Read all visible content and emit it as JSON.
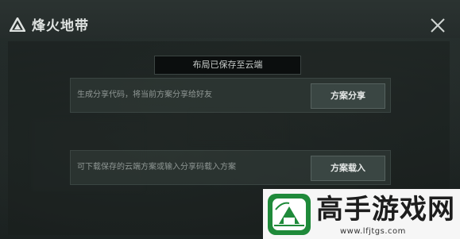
{
  "header": {
    "title": "烽火地带"
  },
  "notice": {
    "text": "布局已保存至云端"
  },
  "rows": [
    {
      "description": "生成分享代码，将当前方案分享给好友",
      "button": "方案分享"
    },
    {
      "description": "可下载保存的云端方案或输入分享码载入方案",
      "button": "方案载入"
    }
  ],
  "watermark": {
    "name": "高手游戏网",
    "url": "www.lfjtgs.com"
  },
  "colors": {
    "accent_green": "#1f8a3a",
    "button_bg": "#3a4643",
    "panel_row": "#34403c"
  }
}
